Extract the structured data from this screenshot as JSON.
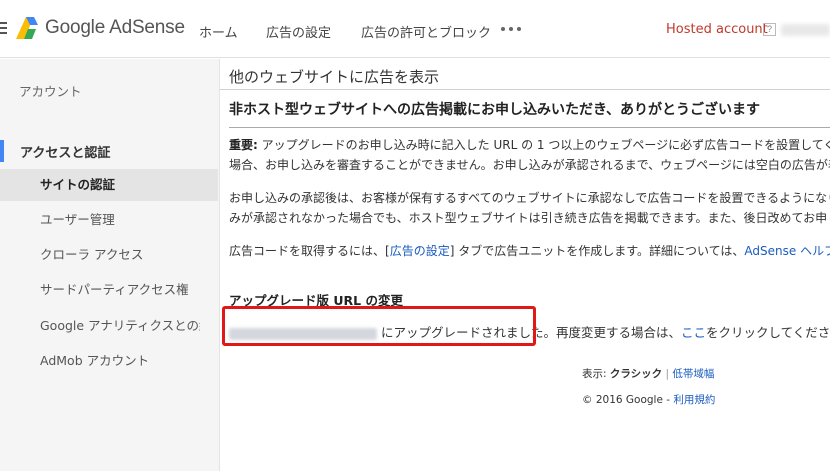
{
  "header": {
    "logo_text": "Google AdSense",
    "nav": {
      "home": "ホーム",
      "ad_settings": "広告の設定",
      "allow_block": "広告の許可とブロック"
    },
    "hosted_account": "Hosted account",
    "help": "?"
  },
  "sidebar": {
    "account": "アカウント",
    "section": "アクセスと認証",
    "items": [
      {
        "label": "サイトの認証"
      },
      {
        "label": "ユーザー管理"
      },
      {
        "label": "クローラ アクセス"
      },
      {
        "label": "サードパーティアクセス権"
      },
      {
        "label": "Google アナリティクスとの統合"
      },
      {
        "label": "AdMob アカウント"
      }
    ]
  },
  "main": {
    "title": "他のウェブサイトに広告を表示",
    "heading": "非ホスト型ウェブサイトへの広告掲載にお申し込みいただき、ありがとうございます",
    "important_label": "重要:",
    "p1_line1": " アップグレードのお申し込み時に記入した URL の 1 つ以上のウェブページに必ず広告コードを設置してください。",
    "p1_line2": "場合、お申し込みを審査することができません。お申し込みが承認されるまで、ウェブページには空白の広告が表示されます。",
    "p2_line1": "お申し込みの承認後は、お客様が保有するすべてのウェブサイトに承認なしで広告コードを設置できるようになります。",
    "p2_line2": "みが承認されなかった場合でも、ホスト型ウェブサイトは引き続き広告を掲載できます。また、後日改めてお申し込みいただけます。",
    "p3_prefix": "広告コードを取得するには、[",
    "p3_link": "広告の設定",
    "p3_mid": "] タブで広告ユニットを作成します。詳細については、",
    "p3_help_link": "AdSense ヘルプセンター",
    "url_change_heading": "アップグレード版 URL の変更",
    "url_text_after": "にアップグレードされました。",
    "url_text_again": "再度変更する場合は、",
    "url_here_link": "ここ",
    "url_text_end": "をクリックしてください。"
  },
  "footer": {
    "display_label": "表示:",
    "classic": "クラシック",
    "separator": "|",
    "low_bandwidth": "低帯域幅",
    "copyright": "© 2016 Google",
    "dash": "-",
    "terms": "利用規約"
  },
  "colors": {
    "accent": "#4285f4",
    "hosted": "#c0392b",
    "highlight": "#e01818",
    "link": "#1a5bbf"
  }
}
